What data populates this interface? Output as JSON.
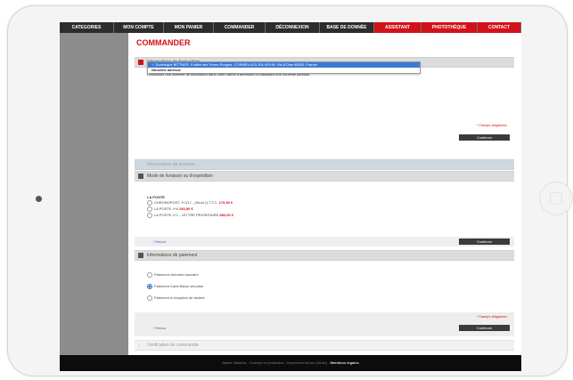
{
  "nav": [
    "CATEGORIES",
    "MON COMPTE",
    "MON PANIER",
    "COMMANDER",
    "DÉCONNEXION",
    "BASE DE DONNÉE",
    "ASSISTANT",
    "PHOTOTHÈQUE",
    "CONTACT"
  ],
  "page_title": "COMMANDER",
  "billing": {
    "header": "Informations de facturation",
    "intro": "Choisissez une adresse de facturation dans votre carnet d'adresses ou saisissez une nouvelle adresse.",
    "options": [
      "Dominique BITTNER, 9 allée des Terres Rouges, CORMEILLES-EN-VEXIN, Val-d'Oise 95830, France",
      "Nouvelle adresse"
    ],
    "required": "* Champs obligatoires",
    "continue": "Continuer"
  },
  "shipping_info_header": "Informations de livraison",
  "shipping_method": {
    "header": "Mode de livraison ou d'expédition",
    "carrier": "LA POSTE",
    "options": [
      {
        "label": "CHRONOPOST J+1/17 - (Seuil 1) T.T.C.",
        "price": "179,50 €"
      },
      {
        "label": "LA POSTE J+6",
        "price": "280,50 €"
      },
      {
        "label": "LA POSTE J+1 - LETTRE PRIORITAIRE",
        "price": "880,69 €"
      }
    ],
    "back": "Retour",
    "continue": "Continuer"
  },
  "payment": {
    "header": "Informations de paiement",
    "options": [
      "Paiement virement bancaire",
      "Paiement Carte Bleue sécurisé",
      "Paiement à réception de facture"
    ],
    "selected": 1,
    "required": "* Champs obligatoires",
    "back": "Retour",
    "continue": "Continuer"
  },
  "review_header": "Vérification de commande",
  "footer": {
    "text": "Atelier Ulisséra - Concept et production : Imprimerie Acrom (Vexin) -",
    "link": "Mentions légales"
  },
  "colors": {
    "accent": "#d2121a",
    "nav": "#2d2d2d",
    "button": "#3b3b3b"
  }
}
